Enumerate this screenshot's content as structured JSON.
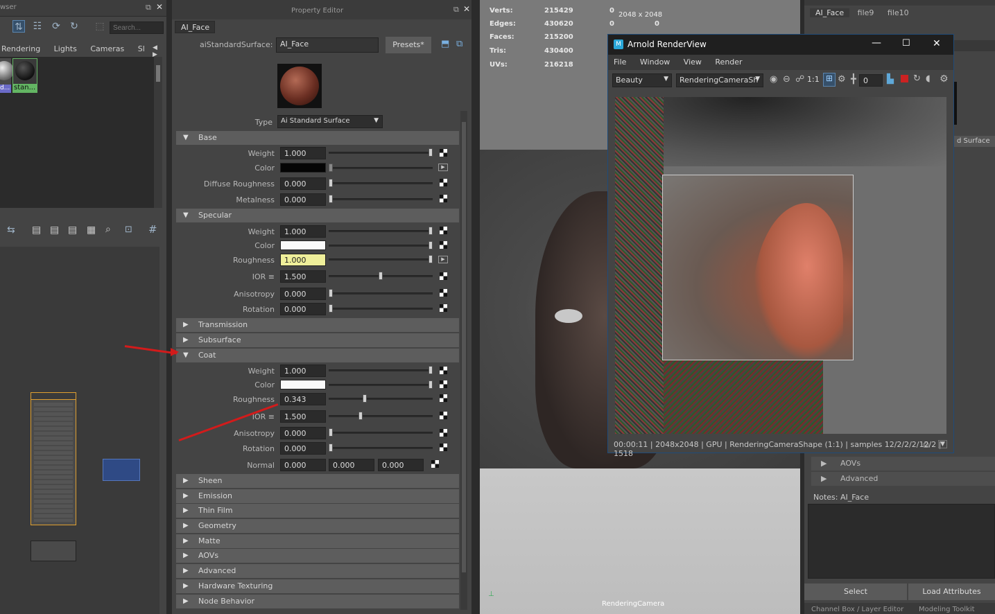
{
  "hypershade": {
    "browser_title": "wser",
    "search_placeholder": "Search...",
    "tabs": [
      "Rendering",
      "Lights",
      "Cameras",
      "Sl"
    ],
    "material_label": "stan...",
    "material_label_left": "d..."
  },
  "property_editor": {
    "title": "Property Editor",
    "node_tab": "AI_Face",
    "shader_label": "aiStandardSurface:",
    "shader_name": "AI_Face",
    "presets_button": "Presets*",
    "type_label": "Type",
    "type_value": "Ai Standard Surface",
    "sections": {
      "base": "Base",
      "specular": "Specular",
      "transmission": "Transmission",
      "subsurface": "Subsurface",
      "coat": "Coat",
      "sheen": "Sheen",
      "emission": "Emission",
      "thin_film": "Thin Film",
      "geometry": "Geometry",
      "matte": "Matte",
      "aovs": "AOVs",
      "advanced": "Advanced",
      "hardware_texturing": "Hardware Texturing",
      "node_behavior": "Node Behavior"
    },
    "base": {
      "weight_label": "Weight",
      "weight": "1.000",
      "color_label": "Color",
      "diffuse_roughness_label": "Diffuse Roughness",
      "diffuse_roughness": "0.000",
      "metalness_label": "Metalness",
      "metalness": "0.000"
    },
    "specular": {
      "weight_label": "Weight",
      "weight": "1.000",
      "color_label": "Color",
      "roughness_label": "Roughness",
      "roughness": "1.000",
      "ior_label": "IOR ≡",
      "ior": "1.500",
      "anisotropy_label": "Anisotropy",
      "anisotropy": "0.000",
      "rotation_label": "Rotation",
      "rotation": "0.000"
    },
    "coat": {
      "weight_label": "Weight",
      "weight": "1.000",
      "color_label": "Color",
      "roughness_label": "Roughness",
      "roughness": "0.343",
      "ior_label": "IOR ≡",
      "ior": "1.500",
      "anisotropy_label": "Anisotropy",
      "anisotropy": "0.000",
      "rotation_label": "Rotation",
      "rotation": "0.000",
      "normal_label": "Normal",
      "normal_x": "0.000",
      "normal_y": "0.000",
      "normal_z": "0.000"
    },
    "slider_levels": {
      "base_weight": 1.0,
      "diffuse_roughness": 0.0,
      "metalness": 0.0,
      "spec_weight": 1.0,
      "spec_roughness": 1.0,
      "spec_ior": 0.5,
      "spec_anisotropy": 0.0,
      "spec_rotation": 0.0,
      "coat_weight": 1.0,
      "coat_roughness": 0.343,
      "coat_ior": 0.3,
      "coat_anisotropy": 0.0,
      "coat_rotation": 0.0
    }
  },
  "viewport": {
    "stats": [
      {
        "label": "Verts:",
        "value": "215429",
        "v2": "0"
      },
      {
        "label": "Edges:",
        "value": "430620",
        "v2": "0",
        "v3": "0"
      },
      {
        "label": "Faces:",
        "value": "215200",
        "v2": "0",
        "v3": "0"
      },
      {
        "label": "Tris:",
        "value": "430400"
      },
      {
        "label": "UVs:",
        "value": "216218"
      }
    ],
    "resolution": "2048 x 2048",
    "camera_label": "RenderingCamera"
  },
  "arnold": {
    "title": "Arnold RenderView",
    "menu": [
      "File",
      "Window",
      "View",
      "Render"
    ],
    "aov": "Beauty",
    "camera": "RenderingCameraSh",
    "ratio": "1:1",
    "exposure": "0",
    "status": "00:00:11 | 2048x2048 | GPU | RenderingCameraShape (1:1) | samples 12/2/2/2/12/2 | 1518"
  },
  "attribute_editor": {
    "tabs": [
      "AI_Face",
      "file9",
      "file10"
    ],
    "surface_label": "d Surface",
    "aovs": "AOVs",
    "advanced": "Advanced",
    "notes_label": "Notes:  AI_Face",
    "select_button": "Select",
    "load_button": "Load Attributes",
    "bottom_tabs": [
      "Channel Box / Layer Editor",
      "Modeling Toolkit"
    ]
  },
  "colors": {
    "accent": "#4a90d9",
    "highlight_field": "#efef9a",
    "annotation_arrow": "#d21b1b"
  }
}
